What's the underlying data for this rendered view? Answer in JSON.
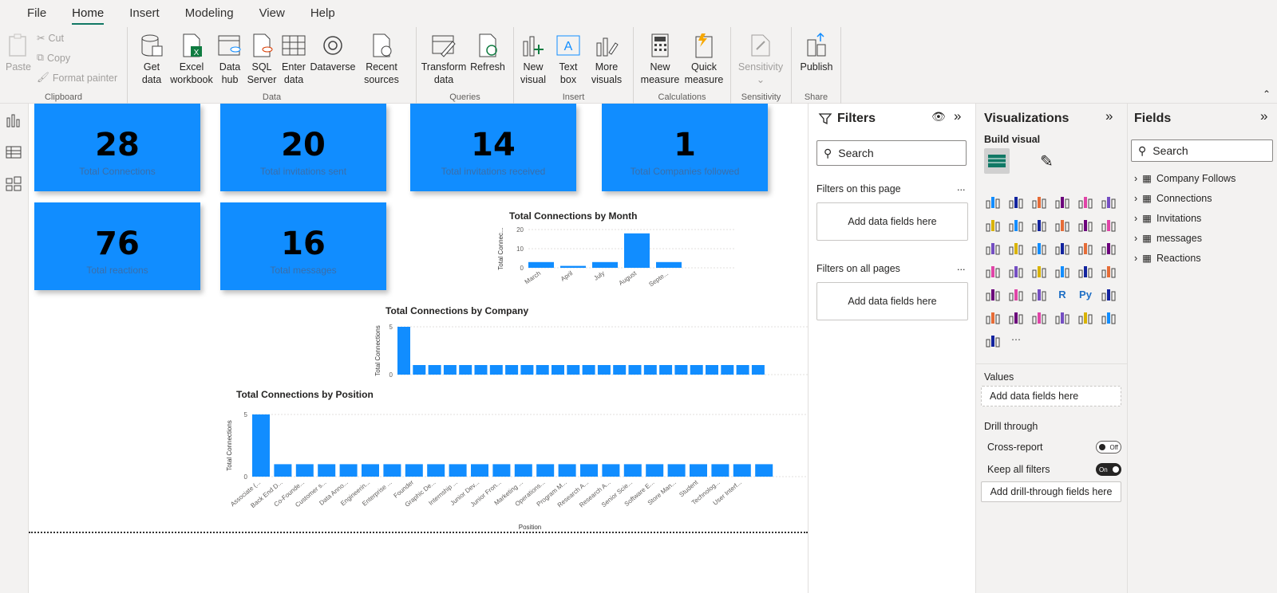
{
  "menu": {
    "tabs": [
      "File",
      "Home",
      "Insert",
      "Modeling",
      "View",
      "Help"
    ]
  },
  "ribbon": {
    "clipboard": {
      "paste": "Paste",
      "cut": "Cut",
      "copy": "Copy",
      "format_painter": "Format painter",
      "label": "Clipboard"
    },
    "data": {
      "get_data": [
        "Get",
        "data"
      ],
      "excel": [
        "Excel",
        "workbook"
      ],
      "data_hub": [
        "Data",
        "hub"
      ],
      "sql": [
        "SQL",
        "Server"
      ],
      "enter": [
        "Enter",
        "data"
      ],
      "dataverse": "Dataverse",
      "recent": [
        "Recent",
        "sources"
      ],
      "label": "Data"
    },
    "queries": {
      "transform": [
        "Transform",
        "data"
      ],
      "refresh": "Refresh",
      "label": "Queries"
    },
    "insert": {
      "new_visual": [
        "New",
        "visual"
      ],
      "text_box": [
        "Text",
        "box"
      ],
      "more": [
        "More",
        "visuals"
      ],
      "label": "Insert"
    },
    "calculations": {
      "new_measure": [
        "New",
        "measure"
      ],
      "quick_measure": [
        "Quick",
        "measure"
      ],
      "label": "Calculations"
    },
    "sensitivity": {
      "btn": "Sensitivity",
      "label": "Sensitivity"
    },
    "share": {
      "publish": "Publish",
      "label": "Share"
    }
  },
  "cards": [
    {
      "value": "28",
      "label": "Total Connections"
    },
    {
      "value": "20",
      "label": "Total invitations sent"
    },
    {
      "value": "14",
      "label": "Total invitations received"
    },
    {
      "value": "1",
      "label": "Total Companies followed"
    },
    {
      "value": "76",
      "label": "Total reactions"
    },
    {
      "value": "16",
      "label": "Total messages"
    }
  ],
  "chart_data": [
    {
      "type": "bar",
      "title": "Total Connections by Month",
      "ylabel": "Total Connec...",
      "categories": [
        "March",
        "April",
        "July",
        "August",
        "Septe..."
      ],
      "values": [
        3,
        1,
        3,
        18,
        3
      ],
      "ylim": [
        0,
        20
      ],
      "yticks": [
        "20",
        "10",
        "0"
      ]
    },
    {
      "type": "bar",
      "title": "Total Connections by Company",
      "ylabel": "Total Connections",
      "values": [
        5,
        1,
        1,
        1,
        1,
        1,
        1,
        1,
        1,
        1,
        1,
        1,
        1,
        1,
        1,
        1,
        1,
        1,
        1,
        1,
        1,
        1,
        1,
        1
      ],
      "ylim": [
        0,
        5
      ],
      "yticks": [
        "5",
        "0"
      ]
    },
    {
      "type": "bar",
      "title": "Total Connections by Position",
      "ylabel": "Total Connections",
      "xlabel": "Position",
      "categories": [
        "Associate (...",
        "Back End D...",
        "Co-Founde...",
        "Customer s...",
        "Data Anno...",
        "Engineerin...",
        "Enterprise ...",
        "Founder",
        "Graphic De...",
        "Internship ...",
        "Junior Dev...",
        "Junior Fron...",
        "Marketing ...",
        "Operations...",
        "Program M...",
        "Research A...",
        "Research A...",
        "Senior Scie...",
        "Software E...",
        "Store Man...",
        "Student",
        "Technolog...",
        "User Interf..."
      ],
      "values": [
        5,
        1,
        1,
        1,
        1,
        1,
        1,
        1,
        1,
        1,
        1,
        1,
        1,
        1,
        1,
        1,
        1,
        1,
        1,
        1,
        1,
        1,
        1,
        1
      ],
      "ylim": [
        0,
        5
      ],
      "yticks": [
        "5",
        "0"
      ]
    }
  ],
  "filters": {
    "title": "Filters",
    "search": "Search",
    "on_page": "Filters on this page",
    "on_all": "Filters on all pages",
    "add": "Add data fields here",
    "more": "..."
  },
  "viz": {
    "title": "Visualizations",
    "build": "Build visual",
    "values": "Values",
    "add": "Add data fields here",
    "drill": "Drill through",
    "cross": "Cross-report",
    "cross_state": "Off",
    "keep": "Keep all filters",
    "keep_state": "On",
    "drill_add": "Add drill-through fields here"
  },
  "fields": {
    "title": "Fields",
    "search": "Search",
    "tables": [
      "Company Follows",
      "Connections",
      "Invitations",
      "messages",
      "Reactions"
    ]
  }
}
